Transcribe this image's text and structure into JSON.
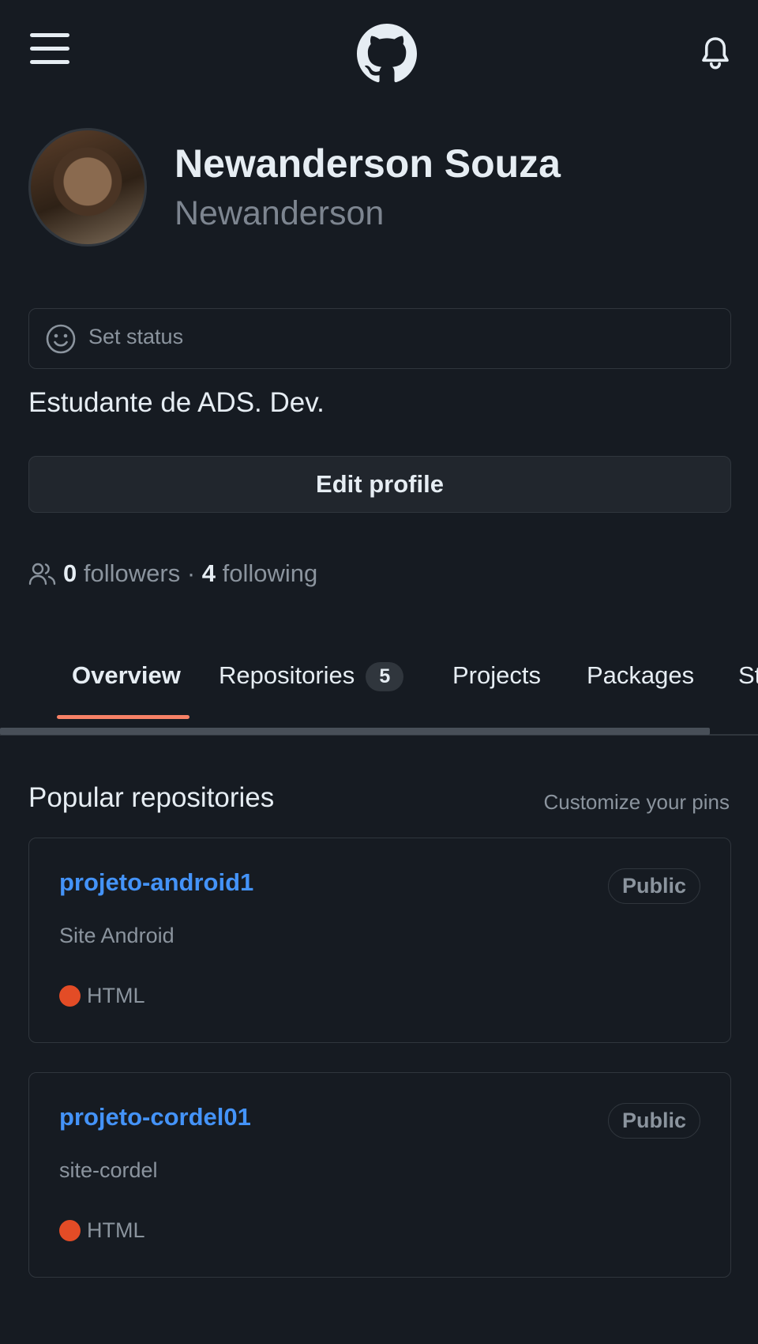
{
  "header": {
    "menu_icon": "hamburger-menu-icon",
    "logo_icon": "github-octocat-icon",
    "notifications_icon": "bell-icon"
  },
  "profile": {
    "name": "Newanderson Souza",
    "login": "Newanderson",
    "status_placeholder": "Set status",
    "bio": "Estudante de ADS. Dev.",
    "edit_button": "Edit profile",
    "followers_count": "0",
    "followers_label": "followers",
    "separator": "·",
    "following_count": "4",
    "following_label": "following"
  },
  "tabs": [
    {
      "label": "Overview",
      "active": true
    },
    {
      "label": "Repositories",
      "count": "5"
    },
    {
      "label": "Projects"
    },
    {
      "label": "Packages"
    },
    {
      "label": "Stars"
    }
  ],
  "popular": {
    "title": "Popular repositories",
    "customize": "Customize your pins",
    "repos": [
      {
        "name": "projeto-android1",
        "visibility": "Public",
        "description": "Site Android",
        "language": "HTML",
        "language_color": "#e34c26"
      },
      {
        "name": "projeto-cordel01",
        "visibility": "Public",
        "description": "site-cordel",
        "language": "HTML",
        "language_color": "#e34c26"
      }
    ]
  },
  "colors": {
    "background": "#161b22",
    "link": "#4493f8",
    "tab_underline": "#f78166",
    "muted": "#8b949e"
  }
}
